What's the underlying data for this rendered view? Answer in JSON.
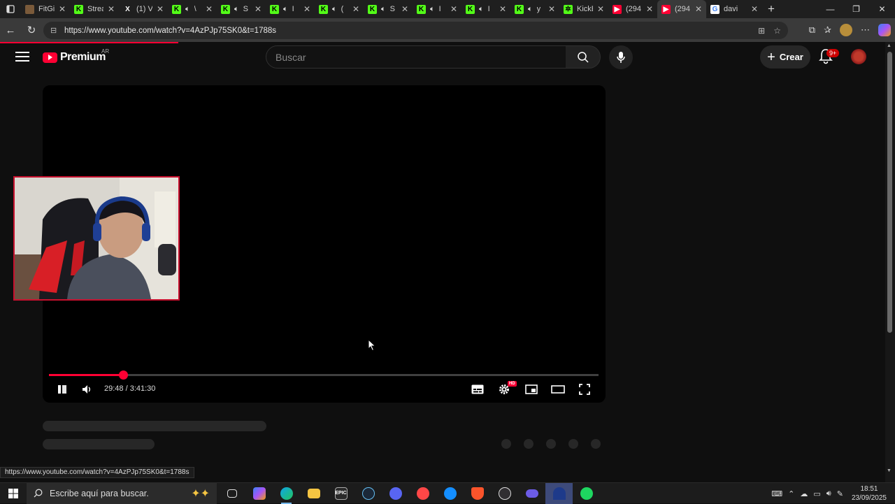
{
  "browser": {
    "tabs": [
      {
        "title": "FitGi",
        "fav_color": "#7a5a3a",
        "fav_char": "",
        "has_speaker": false,
        "active": false
      },
      {
        "title": "Strea",
        "fav_color": "#53fc18",
        "fav_char": "K",
        "has_speaker": false,
        "active": false
      },
      {
        "title": "(1) Vi",
        "fav_color": "#1f1f1f",
        "fav_char": "X",
        "has_speaker": false,
        "active": false
      },
      {
        "title": "\\",
        "fav_color": "#53fc18",
        "fav_char": "K",
        "has_speaker": true,
        "active": false
      },
      {
        "title": "S",
        "fav_color": "#53fc18",
        "fav_char": "K",
        "has_speaker": true,
        "active": false
      },
      {
        "title": "I",
        "fav_color": "#53fc18",
        "fav_char": "K",
        "has_speaker": true,
        "active": false
      },
      {
        "title": "(",
        "fav_color": "#53fc18",
        "fav_char": "K",
        "has_speaker": true,
        "active": false
      },
      {
        "title": "S",
        "fav_color": "#53fc18",
        "fav_char": "K",
        "has_speaker": true,
        "active": false
      },
      {
        "title": "I",
        "fav_color": "#53fc18",
        "fav_char": "K",
        "has_speaker": true,
        "active": false
      },
      {
        "title": "I",
        "fav_color": "#53fc18",
        "fav_char": "K",
        "has_speaker": true,
        "active": false
      },
      {
        "title": "y",
        "fav_color": "#53fc18",
        "fav_char": "K",
        "has_speaker": true,
        "active": false
      },
      {
        "title": "KickE",
        "fav_color": "#53fc18",
        "fav_char": "✲",
        "has_speaker": false,
        "active": false
      },
      {
        "title": "(294",
        "fav_color": "#ff0033",
        "fav_char": "▶",
        "has_speaker": false,
        "active": false
      },
      {
        "title": "(294",
        "fav_color": "#ff0033",
        "fav_char": "▶",
        "has_speaker": false,
        "active": true
      },
      {
        "title": "davi",
        "fav_color": "#ffffff",
        "fav_char": "G",
        "has_speaker": false,
        "active": false
      }
    ],
    "url": "https://www.youtube.com/watch?v=4AzPJp75SK0&t=1788s",
    "status_url": "https://www.youtube.com/watch?v=4AzPJp75SK0&t=1788s"
  },
  "youtube": {
    "logo_text": "Premium",
    "country_code": "AR",
    "search_placeholder": "Buscar",
    "create_label": "Crear",
    "notif_badge": "9+",
    "player": {
      "time_display": "29:48 / 3:41:30",
      "progress_fraction": 0.1345,
      "quality_badge": "HD"
    }
  },
  "taskbar": {
    "search_placeholder": "Escribe aquí para buscar.",
    "clock_time": "18:51",
    "clock_date": "23/09/2025",
    "apps": [
      "task-view-icon",
      "copilot-icon",
      "edge-icon",
      "file-explorer-icon",
      "epic-games-icon",
      "steam-icon",
      "discord-icon",
      "ea-icon",
      "battlenet-icon",
      "brave-icon",
      "obs-icon",
      "game-controller-icon",
      "app-icon",
      "spotify-icon"
    ]
  },
  "colors": {
    "yt_red": "#ff0033",
    "kick_green": "#53fc18",
    "background": "#0f0f0f"
  }
}
